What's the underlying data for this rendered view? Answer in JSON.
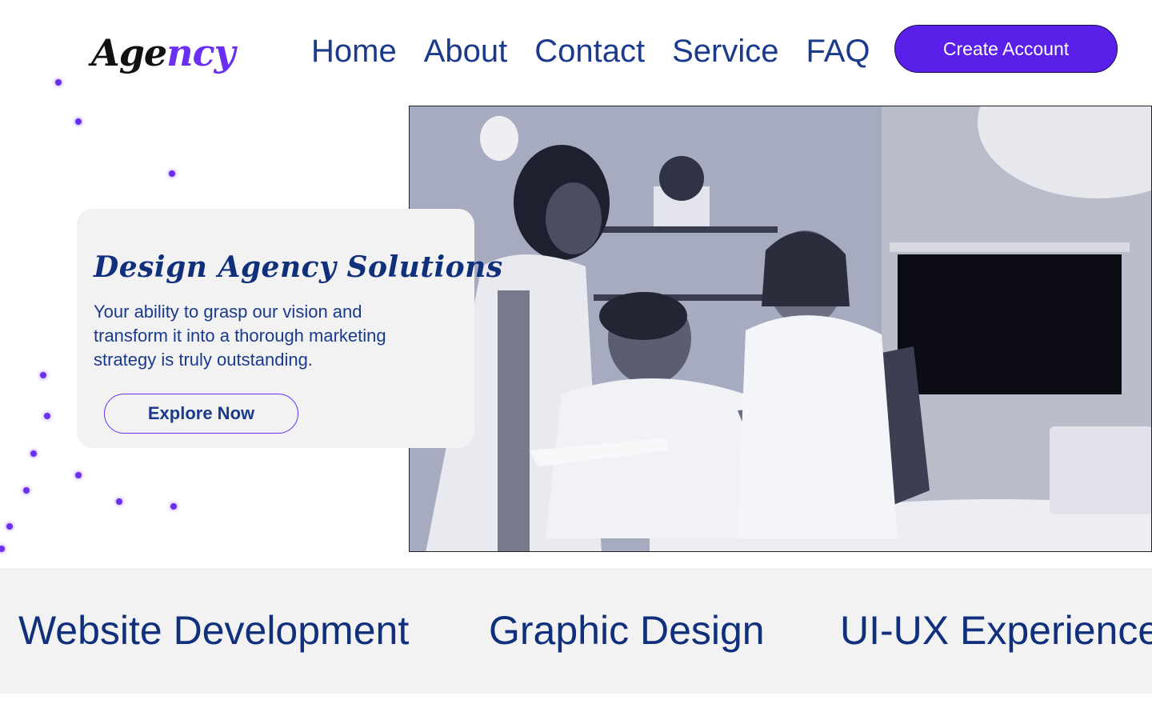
{
  "header": {
    "logo": {
      "part1": "Age",
      "part2": "ncy"
    },
    "nav": [
      "Home",
      "About",
      "Contact",
      "Service",
      "FAQ"
    ],
    "cta_label": "Create Account"
  },
  "hero": {
    "title": "Design Agency Solutions",
    "description": "Your ability to grasp our vision and transform it into a thorough marketing strategy is truly outstanding.",
    "button_label": "Explore Now"
  },
  "services": [
    "Website Development",
    "Graphic Design",
    "UI-UX Experience"
  ],
  "colors": {
    "brand_purple": "#5a1fe8",
    "brand_navy": "#10307c",
    "panel_gray": "#f2f2f3"
  },
  "icons": [
    "decorative-dot"
  ]
}
